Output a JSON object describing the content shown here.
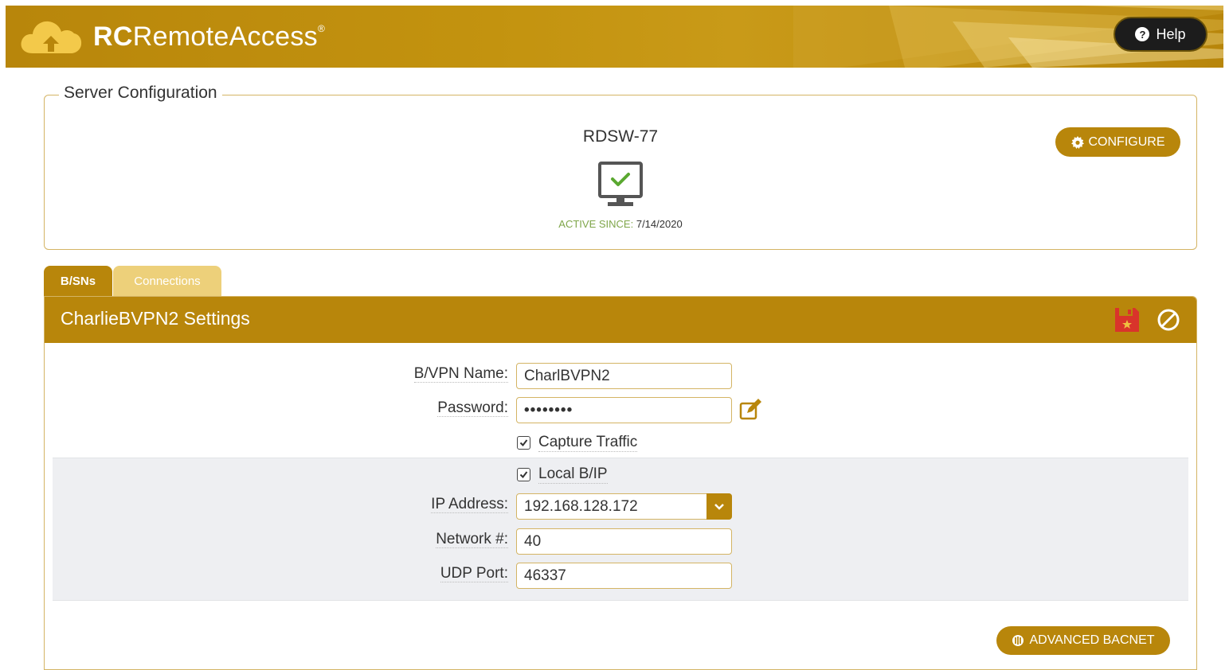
{
  "header": {
    "logo_bold": "RC",
    "logo_rest": "RemoteAccess",
    "logo_mark": "®",
    "help_label": "Help",
    "logo_icon": "cloud-icon",
    "help_icon": "question-circle-icon"
  },
  "server_config": {
    "legend": "Server Configuration",
    "server_name": "RDSW-77",
    "status_icon": "monitor-check-icon",
    "active_since_label": "ACTIVE SINCE:",
    "active_since_date": "7/14/2020",
    "configure_label": "CONFIGURE",
    "configure_icon": "gear-icon"
  },
  "tabs": [
    {
      "label": "B/SNs",
      "active": true
    },
    {
      "label": "Connections",
      "active": false
    }
  ],
  "settings": {
    "title": "CharlieBVPN2 Settings",
    "save_icon": "save-icon",
    "cancel_icon": "cancel-icon",
    "fields": {
      "bvpn_name_label": "B/VPN Name:",
      "bvpn_name_value": "CharlBVPN2",
      "password_label": "Password:",
      "password_value": "••••••••",
      "capture_traffic_label": "Capture Traffic",
      "capture_traffic_checked": true,
      "local_bip_label": "Local B/IP",
      "local_bip_checked": true,
      "ip_address_label": "IP Address:",
      "ip_address_value": "192.168.128.172",
      "network_label": "Network #:",
      "network_value": "40",
      "udp_port_label": "UDP Port:",
      "udp_port_value": "46337"
    },
    "advanced_label": "ADVANCED BACNET"
  },
  "colors": {
    "brand_gold": "#b8860b",
    "tab_inactive": "#edd07a",
    "active_green": "#7fa64a",
    "save_red": "#d9342b"
  }
}
